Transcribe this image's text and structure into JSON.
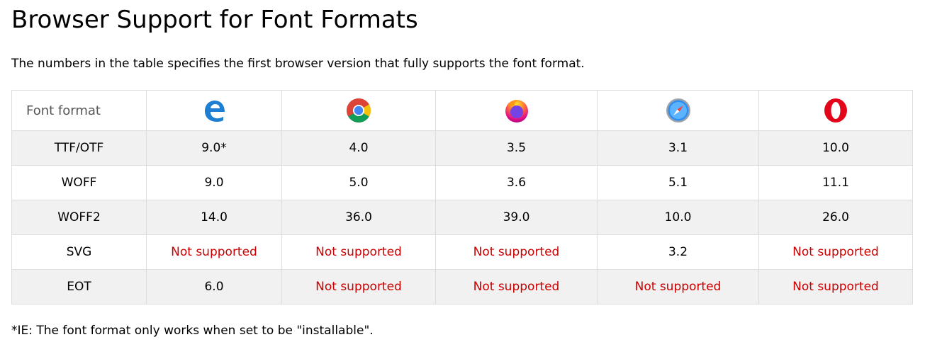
{
  "page": {
    "title": "Browser Support for Font Formats",
    "intro": "The numbers in the table specifies the first browser version that fully supports the font format.",
    "footnote": "*IE: The font format only works when set to be \"installable\"."
  },
  "table": {
    "header_label": "Font format",
    "browsers": [
      {
        "icon": "edge-browser-icon"
      },
      {
        "icon": "chrome-browser-icon"
      },
      {
        "icon": "firefox-browser-icon"
      },
      {
        "icon": "safari-browser-icon"
      },
      {
        "icon": "opera-browser-icon"
      }
    ],
    "rows": [
      {
        "format": "TTF/OTF",
        "cells": [
          "9.0*",
          "4.0",
          "3.5",
          "3.1",
          "10.0"
        ]
      },
      {
        "format": "WOFF",
        "cells": [
          "9.0",
          "5.0",
          "3.6",
          "5.1",
          "11.1"
        ]
      },
      {
        "format": "WOFF2",
        "cells": [
          "14.0",
          "36.0",
          "39.0",
          "10.0",
          "26.0"
        ]
      },
      {
        "format": "SVG",
        "cells": [
          "Not supported",
          "Not supported",
          "Not supported",
          "3.2",
          "Not supported"
        ]
      },
      {
        "format": "EOT",
        "cells": [
          "6.0",
          "Not supported",
          "Not supported",
          "Not supported",
          "Not supported"
        ]
      }
    ],
    "unsupported_color": "#cc0000"
  }
}
